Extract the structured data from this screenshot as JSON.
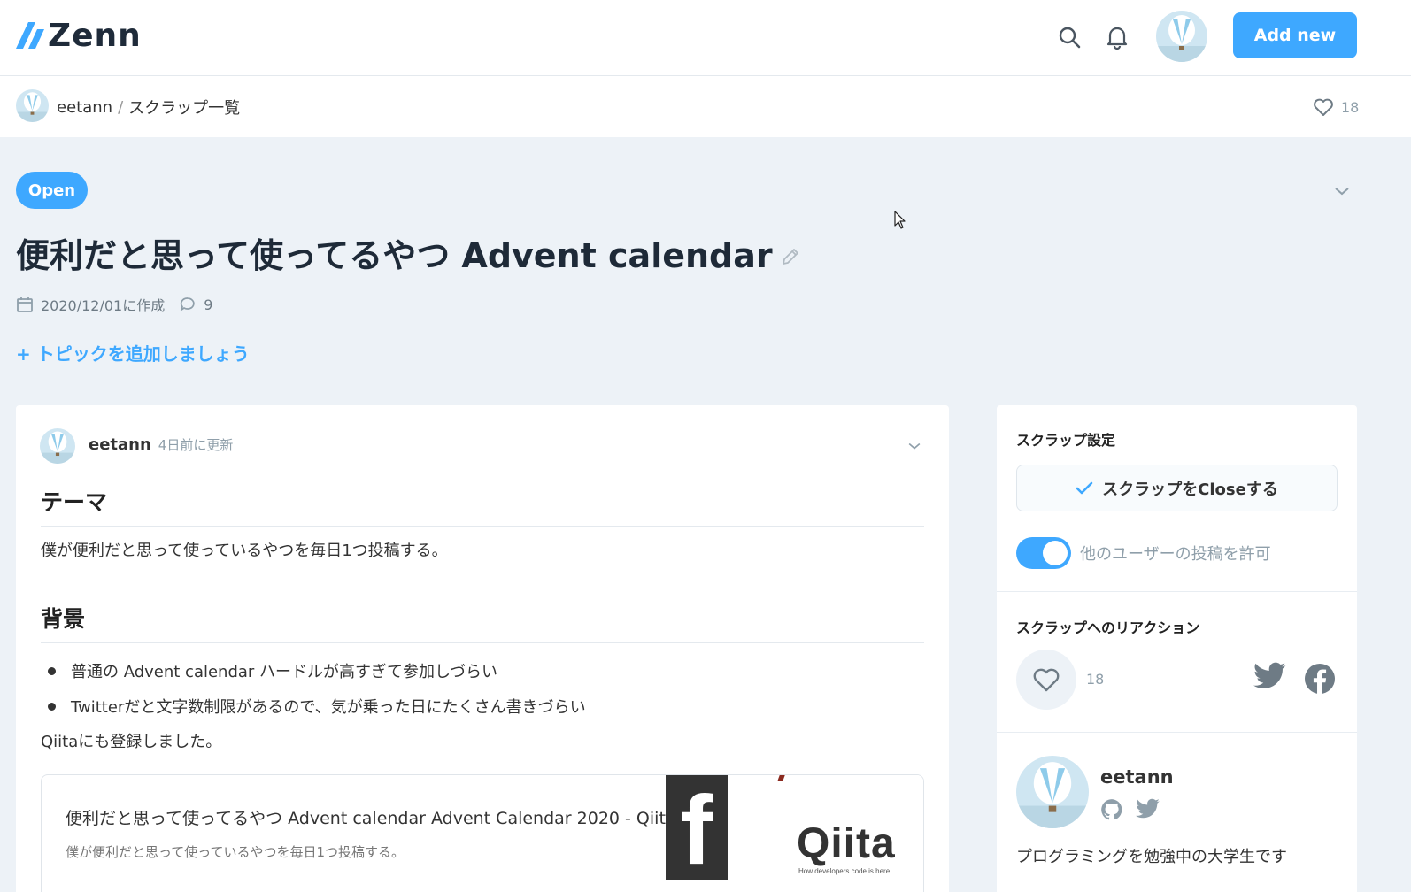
{
  "header": {
    "logo_text": "Zenn",
    "add_new_label": "Add new",
    "icons": [
      "search-icon",
      "bell-icon",
      "avatar"
    ]
  },
  "subheader": {
    "user": "eetann",
    "separator": "/",
    "page": "スクラップ一覧",
    "likes": "18"
  },
  "scrap": {
    "status": "Open",
    "title": "便利だと思って使ってるやつ Advent calendar",
    "created": "2020/12/01に作成",
    "comments": "9",
    "add_topic": "+ トピックを追加しましょう"
  },
  "post": {
    "user": "eetann",
    "updated": "4日前に更新",
    "heading1": "テーマ",
    "para1": "僕が便利だと思って使っているやつを毎日1つ投稿する。",
    "heading2": "背景",
    "bullets": [
      "普通の Advent calendar ハードルが高すぎて参加しづらい",
      "Twitterだと文字数制限があるので、気が乗った日にたくさん書きづらい"
    ],
    "para2": "Qiitaにも登録しました。",
    "link_card": {
      "title": "便利だと思って使ってるやつ Advent calendar Advent Calendar 2020 - Qiita",
      "description": "僕が便利だと思って使っているやつを毎日1つ投稿する。",
      "thumb_fb": "f",
      "thumb_logo": "Qiita",
      "thumb_tagline": "How developers code is here."
    }
  },
  "sidebar": {
    "settings_title": "スクラップ設定",
    "close_label": "スクラップをCloseする",
    "toggle_label": "他のユーザーの投稿を許可",
    "toggle_on": true,
    "reaction_title": "スクラップへのリアクション",
    "like_count": "18",
    "profile_name": "eetann",
    "profile_bio": "プログラミングを勉強中の大学生です"
  },
  "colors": {
    "accent": "#3ea8ff",
    "background": "#edf2f7",
    "text": "#333333",
    "muted": "#8f9faa"
  }
}
